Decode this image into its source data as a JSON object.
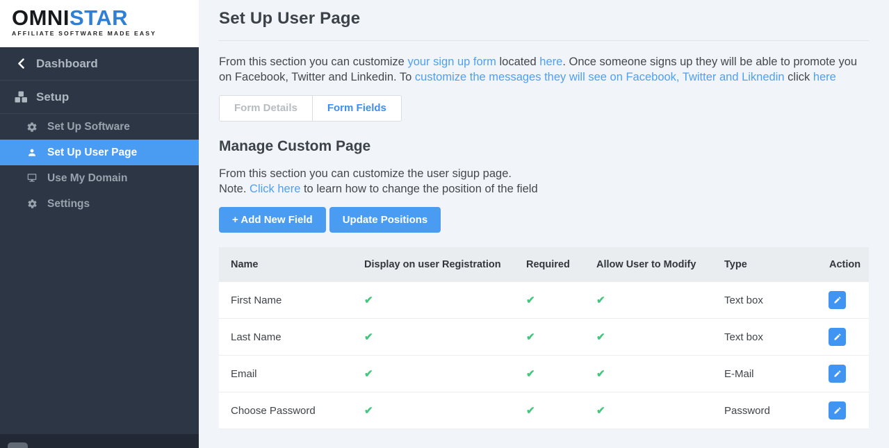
{
  "brand": {
    "name_primary": "OMNI",
    "name_secondary": "STAR",
    "tagline": "AFFILIATE SOFTWARE MADE EASY"
  },
  "colors": {
    "sidebar_bg": "#2d3644",
    "accent_blue": "#4a9cf2",
    "link_blue": "#4f9ff4",
    "check_green": "#42c77d",
    "logo_blue": "#2f7fd6"
  },
  "sidebar": {
    "back_item": {
      "label": "Dashboard",
      "icon": "chevron-left-icon"
    },
    "section": {
      "label": "Setup",
      "icon": "cubes-icon"
    },
    "items": [
      {
        "label": "Set Up Software",
        "icon": "gears-icon",
        "active": false
      },
      {
        "label": "Set Up User Page",
        "icon": "user-icon",
        "active": true
      },
      {
        "label": "Use My Domain",
        "icon": "monitor-icon",
        "active": false
      },
      {
        "label": "Settings",
        "icon": "gear-icon",
        "active": false
      }
    ]
  },
  "header": {
    "title": "Set Up User Page"
  },
  "intro": {
    "segments": [
      {
        "text": "From this section you can customize "
      },
      {
        "text": "your sign up form",
        "link": true
      },
      {
        "text": " located "
      },
      {
        "text": "here",
        "link": true
      },
      {
        "text": ". Once someone signs up they will be able to promote you on Facebook, Twitter and Linkedin. To "
      },
      {
        "text": "customize the messages they will see on Facebook, Twitter and Liknedin",
        "link": true
      },
      {
        "text": " click "
      },
      {
        "text": "here",
        "link": true
      }
    ]
  },
  "tabs": [
    {
      "label": "Form Details",
      "active": false
    },
    {
      "label": "Form Fields",
      "active": true
    }
  ],
  "section": {
    "title": "Manage Custom Page",
    "line1": "From this section you can customize the user sigup page.",
    "note_segments": [
      {
        "text": "Note. "
      },
      {
        "text": "Click here",
        "link": true
      },
      {
        "text": " to learn how to change the position of the field"
      }
    ]
  },
  "buttons": {
    "add_label": "+ Add New Field",
    "update_label": "Update Positions"
  },
  "table": {
    "headers": [
      "Name",
      "Display on user Registration",
      "Required",
      "Allow User to Modify",
      "Type",
      "Action"
    ],
    "rows": [
      {
        "name": "First Name",
        "display": true,
        "required": true,
        "modify": true,
        "type": "Text box"
      },
      {
        "name": "Last Name",
        "display": true,
        "required": true,
        "modify": true,
        "type": "Text box"
      },
      {
        "name": "Email",
        "display": true,
        "required": true,
        "modify": true,
        "type": "E-Mail"
      },
      {
        "name": "Choose Password",
        "display": true,
        "required": true,
        "modify": true,
        "type": "Password"
      }
    ],
    "check_glyph": "✔"
  }
}
